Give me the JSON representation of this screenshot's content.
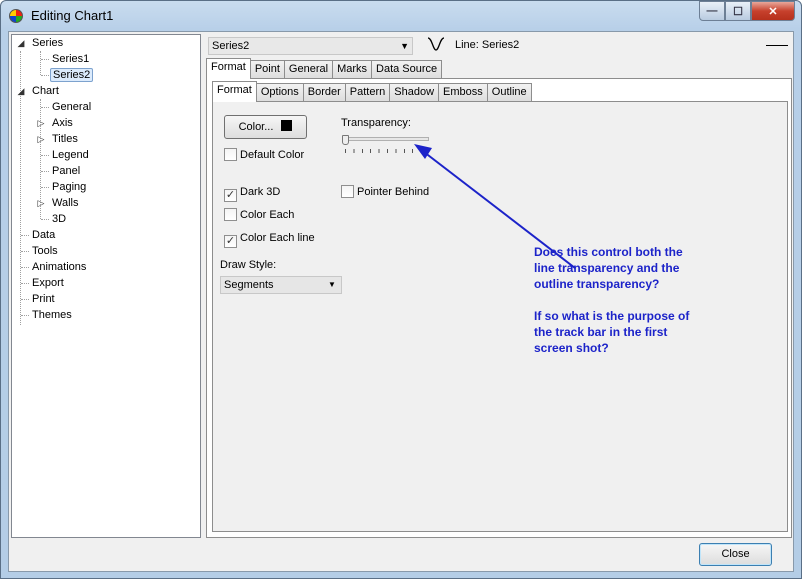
{
  "window": {
    "title": "Editing Chart1",
    "buttons": {
      "minimize": "—",
      "maximize": "☐",
      "close": "✕"
    }
  },
  "tree": {
    "items": [
      {
        "label": "Series",
        "expander": "◢"
      },
      {
        "label": "Series1"
      },
      {
        "label": "Series2",
        "selected": true
      },
      {
        "label": "Chart",
        "expander": "◢"
      },
      {
        "label": "General"
      },
      {
        "label": "Axis",
        "expander": "▷"
      },
      {
        "label": "Titles",
        "expander": "▷"
      },
      {
        "label": "Legend"
      },
      {
        "label": "Panel"
      },
      {
        "label": "Paging"
      },
      {
        "label": "Walls",
        "expander": "▷"
      },
      {
        "label": "3D"
      },
      {
        "label": "Data"
      },
      {
        "label": "Tools"
      },
      {
        "label": "Animations"
      },
      {
        "label": "Export"
      },
      {
        "label": "Print"
      },
      {
        "label": "Themes"
      }
    ]
  },
  "series_selector": {
    "value": "Series2",
    "arrow": "▼"
  },
  "line_caption": "Line: Series2",
  "main_tabs": [
    "Format",
    "Point",
    "General",
    "Marks",
    "Data Source"
  ],
  "sub_tabs": [
    "Format",
    "Options",
    "Border",
    "Pattern",
    "Shadow",
    "Emboss",
    "Outline"
  ],
  "format": {
    "color_button": "Color...",
    "default_color": {
      "label": "Default Color",
      "checked": false
    },
    "transparency_label": "Transparency:",
    "transparency_value": 0,
    "dark3d": {
      "label": "Dark 3D",
      "checked": true
    },
    "pointer_behind": {
      "label": "Pointer Behind",
      "checked": false
    },
    "color_each": {
      "label": "Color Each",
      "checked": false
    },
    "color_each_line": {
      "label": "Color Each line",
      "checked": true
    },
    "draw_style_label": "Draw Style:",
    "draw_style_value": "Segments",
    "check_mark": "✓",
    "dropdown_arrow": "▼"
  },
  "annotation": {
    "paragraph1": "Does this control both the line transparency and the outline transparency?",
    "paragraph2": "If so what is the purpose of the track bar in the first screen shot?",
    "color": "#1c23c9"
  },
  "close_button": "Close"
}
